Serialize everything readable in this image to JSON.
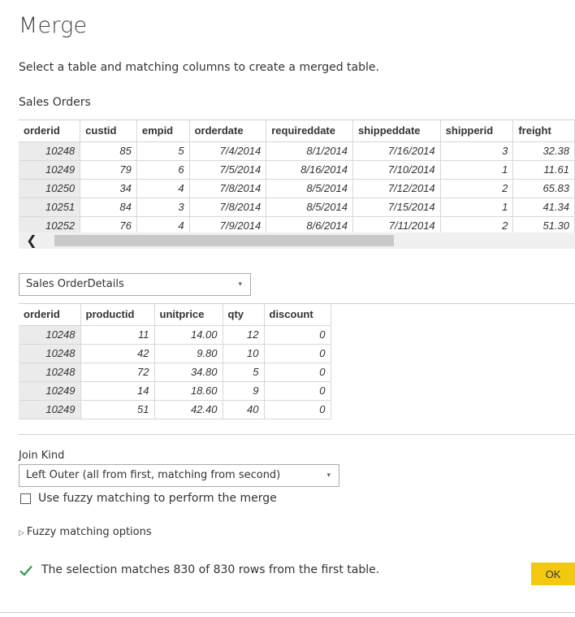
{
  "dialog": {
    "title": "Merge",
    "subtitle": "Select a table and matching columns to create a merged table."
  },
  "first_table": {
    "name": "Sales Orders",
    "columns": [
      "orderid",
      "custid",
      "empid",
      "orderdate",
      "requireddate",
      "shippeddate",
      "shipperid",
      "freight"
    ],
    "rows": [
      [
        "10248",
        "85",
        "5",
        "7/4/2014",
        "8/1/2014",
        "7/16/2014",
        "3",
        "32.38"
      ],
      [
        "10249",
        "79",
        "6",
        "7/5/2014",
        "8/16/2014",
        "7/10/2014",
        "1",
        "11.61"
      ],
      [
        "10250",
        "34",
        "4",
        "7/8/2014",
        "8/5/2014",
        "7/12/2014",
        "2",
        "65.83"
      ],
      [
        "10251",
        "84",
        "3",
        "7/8/2014",
        "8/5/2014",
        "7/15/2014",
        "1",
        "41.34"
      ],
      [
        "10252",
        "76",
        "4",
        "7/9/2014",
        "8/6/2014",
        "7/11/2014",
        "2",
        "51.30"
      ]
    ]
  },
  "scrollbar": {
    "left_arrow": "❮"
  },
  "second_table": {
    "selected": "Sales OrderDetails",
    "caret": "▾",
    "columns": [
      "orderid",
      "productid",
      "unitprice",
      "qty",
      "discount"
    ],
    "rows": [
      [
        "10248",
        "11",
        "14.00",
        "12",
        "0"
      ],
      [
        "10248",
        "42",
        "9.80",
        "10",
        "0"
      ],
      [
        "10248",
        "72",
        "34.80",
        "5",
        "0"
      ],
      [
        "10249",
        "14",
        "18.60",
        "9",
        "0"
      ],
      [
        "10249",
        "51",
        "42.40",
        "40",
        "0"
      ]
    ]
  },
  "join": {
    "label": "Join Kind",
    "selected": "Left Outer (all from first, matching from second)",
    "caret": "▾"
  },
  "fuzzy": {
    "checkbox_label": "Use fuzzy matching to perform the merge",
    "checked": false,
    "options_label": "Fuzzy matching options",
    "options_toggle": "▷"
  },
  "status": {
    "icon": "check-icon",
    "text": "The selection matches 830 of 830 rows from the first table.",
    "color": "#2e9e4f"
  },
  "buttons": {
    "ok": "OK",
    "ok_color": "#f2c811"
  }
}
